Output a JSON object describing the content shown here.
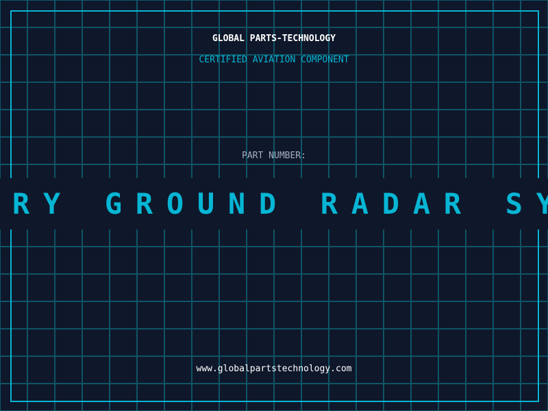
{
  "header": {
    "title": "GLOBAL PARTS-TECHNOLOGY",
    "subtitle": "CERTIFIED AVIATION COMPONENT"
  },
  "part": {
    "label": "PART NUMBER:",
    "value": "PRIMARY GROUND RADAR SYSTEM"
  },
  "footer": {
    "url": "www.globalpartstechnology.com"
  },
  "colors": {
    "background": "#0f172a",
    "grid": "#0e5566",
    "accent": "#06b6d4",
    "text": "#ffffff",
    "muted": "#a6b1c2"
  }
}
